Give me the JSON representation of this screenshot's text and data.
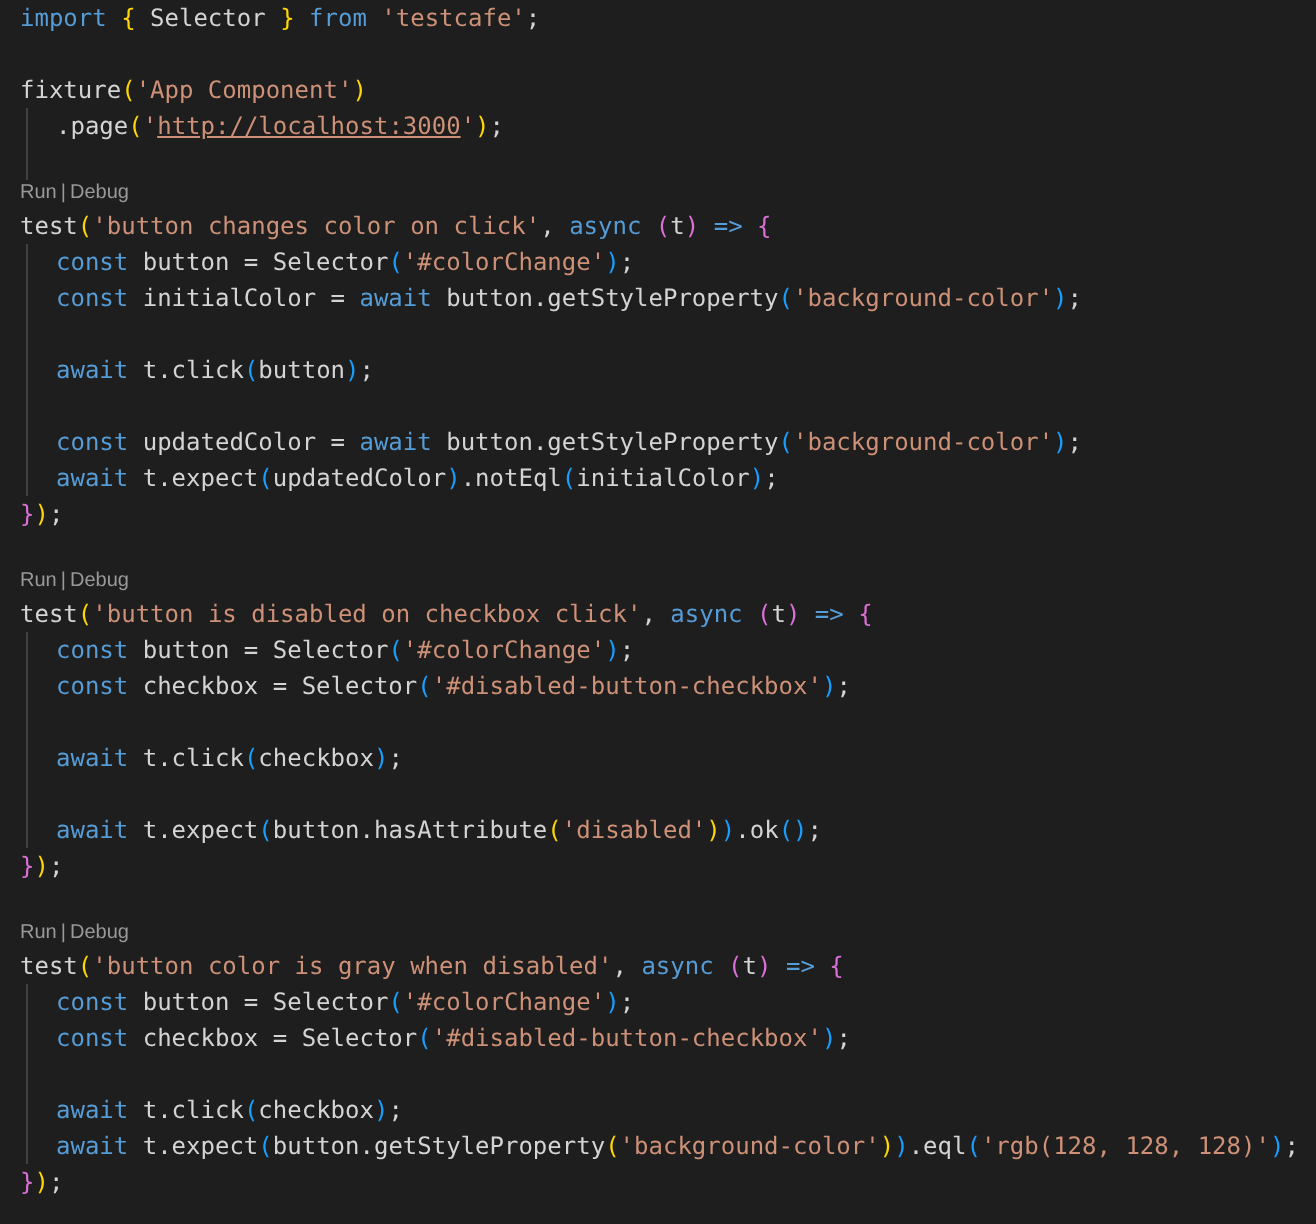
{
  "editor": {
    "lines": [
      {
        "kind": "code",
        "indented": false,
        "tokens": [
          {
            "kind": "keyword",
            "text": "import "
          },
          {
            "kind": "bracket1",
            "text": "{"
          },
          {
            "kind": "plain",
            "text": " Selector "
          },
          {
            "kind": "bracket1",
            "text": "}"
          },
          {
            "kind": "keyword",
            "text": " from "
          },
          {
            "kind": "string",
            "text": "'testcafe'"
          },
          {
            "kind": "plain",
            "text": ";"
          }
        ]
      },
      {
        "kind": "blank",
        "indented": false
      },
      {
        "kind": "code",
        "indented": false,
        "tokens": [
          {
            "kind": "plain",
            "text": "fixture"
          },
          {
            "kind": "bracket1",
            "text": "("
          },
          {
            "kind": "string",
            "text": "'App Component'"
          },
          {
            "kind": "bracket1",
            "text": ")"
          }
        ]
      },
      {
        "kind": "code",
        "indented": true,
        "tokens": [
          {
            "kind": "plain",
            "text": ".page"
          },
          {
            "kind": "bracket1",
            "text": "("
          },
          {
            "kind": "string",
            "text": "'"
          },
          {
            "kind": "link",
            "text": "http://localhost:3000"
          },
          {
            "kind": "string",
            "text": "'"
          },
          {
            "kind": "bracket1",
            "text": ")"
          },
          {
            "kind": "plain",
            "text": ";"
          }
        ]
      },
      {
        "kind": "blank",
        "indented": true
      },
      {
        "kind": "codelens",
        "run": "Run",
        "sep": "|",
        "debug": "Debug"
      },
      {
        "kind": "code",
        "indented": false,
        "tokens": [
          {
            "kind": "plain",
            "text": "test"
          },
          {
            "kind": "bracket1",
            "text": "("
          },
          {
            "kind": "string",
            "text": "'button changes color on click'"
          },
          {
            "kind": "plain",
            "text": ", "
          },
          {
            "kind": "keyword",
            "text": "async "
          },
          {
            "kind": "bracket2",
            "text": "("
          },
          {
            "kind": "plain",
            "text": "t"
          },
          {
            "kind": "bracket2",
            "text": ")"
          },
          {
            "kind": "keyword",
            "text": " => "
          },
          {
            "kind": "bracket2",
            "text": "{"
          }
        ]
      },
      {
        "kind": "code",
        "indented": true,
        "tokens": [
          {
            "kind": "keyword",
            "text": "const "
          },
          {
            "kind": "plain",
            "text": "button = Selector"
          },
          {
            "kind": "bracket3",
            "text": "("
          },
          {
            "kind": "string",
            "text": "'#colorChange'"
          },
          {
            "kind": "bracket3",
            "text": ")"
          },
          {
            "kind": "plain",
            "text": ";"
          }
        ]
      },
      {
        "kind": "code",
        "indented": true,
        "tokens": [
          {
            "kind": "keyword",
            "text": "const "
          },
          {
            "kind": "plain",
            "text": "initialColor = "
          },
          {
            "kind": "keyword",
            "text": "await "
          },
          {
            "kind": "plain",
            "text": "button.getStyleProperty"
          },
          {
            "kind": "bracket3",
            "text": "("
          },
          {
            "kind": "string",
            "text": "'background-color'"
          },
          {
            "kind": "bracket3",
            "text": ")"
          },
          {
            "kind": "plain",
            "text": ";"
          }
        ]
      },
      {
        "kind": "blank",
        "indented": true
      },
      {
        "kind": "code",
        "indented": true,
        "tokens": [
          {
            "kind": "keyword",
            "text": "await "
          },
          {
            "kind": "plain",
            "text": "t.click"
          },
          {
            "kind": "bracket3",
            "text": "("
          },
          {
            "kind": "plain",
            "text": "button"
          },
          {
            "kind": "bracket3",
            "text": ")"
          },
          {
            "kind": "plain",
            "text": ";"
          }
        ]
      },
      {
        "kind": "blank",
        "indented": true
      },
      {
        "kind": "code",
        "indented": true,
        "tokens": [
          {
            "kind": "keyword",
            "text": "const "
          },
          {
            "kind": "plain",
            "text": "updatedColor = "
          },
          {
            "kind": "keyword",
            "text": "await "
          },
          {
            "kind": "plain",
            "text": "button.getStyleProperty"
          },
          {
            "kind": "bracket3",
            "text": "("
          },
          {
            "kind": "string",
            "text": "'background-color'"
          },
          {
            "kind": "bracket3",
            "text": ")"
          },
          {
            "kind": "plain",
            "text": ";"
          }
        ]
      },
      {
        "kind": "code",
        "indented": true,
        "tokens": [
          {
            "kind": "keyword",
            "text": "await "
          },
          {
            "kind": "plain",
            "text": "t.expect"
          },
          {
            "kind": "bracket3",
            "text": "("
          },
          {
            "kind": "plain",
            "text": "updatedColor"
          },
          {
            "kind": "bracket3",
            "text": ")"
          },
          {
            "kind": "plain",
            "text": ".notEql"
          },
          {
            "kind": "bracket3",
            "text": "("
          },
          {
            "kind": "plain",
            "text": "initialColor"
          },
          {
            "kind": "bracket3",
            "text": ")"
          },
          {
            "kind": "plain",
            "text": ";"
          }
        ]
      },
      {
        "kind": "code",
        "indented": false,
        "tokens": [
          {
            "kind": "bracket2",
            "text": "}"
          },
          {
            "kind": "bracket1",
            "text": ")"
          },
          {
            "kind": "plain",
            "text": ";"
          }
        ]
      },
      {
        "kind": "blank",
        "indented": false
      },
      {
        "kind": "codelens",
        "run": "Run",
        "sep": "|",
        "debug": "Debug"
      },
      {
        "kind": "code",
        "indented": false,
        "tokens": [
          {
            "kind": "plain",
            "text": "test"
          },
          {
            "kind": "bracket1",
            "text": "("
          },
          {
            "kind": "string",
            "text": "'button is disabled on checkbox click'"
          },
          {
            "kind": "plain",
            "text": ", "
          },
          {
            "kind": "keyword",
            "text": "async "
          },
          {
            "kind": "bracket2",
            "text": "("
          },
          {
            "kind": "plain",
            "text": "t"
          },
          {
            "kind": "bracket2",
            "text": ")"
          },
          {
            "kind": "keyword",
            "text": " => "
          },
          {
            "kind": "bracket2",
            "text": "{"
          }
        ]
      },
      {
        "kind": "code",
        "indented": true,
        "tokens": [
          {
            "kind": "keyword",
            "text": "const "
          },
          {
            "kind": "plain",
            "text": "button = Selector"
          },
          {
            "kind": "bracket3",
            "text": "("
          },
          {
            "kind": "string",
            "text": "'#colorChange'"
          },
          {
            "kind": "bracket3",
            "text": ")"
          },
          {
            "kind": "plain",
            "text": ";"
          }
        ]
      },
      {
        "kind": "code",
        "indented": true,
        "tokens": [
          {
            "kind": "keyword",
            "text": "const "
          },
          {
            "kind": "plain",
            "text": "checkbox = Selector"
          },
          {
            "kind": "bracket3",
            "text": "("
          },
          {
            "kind": "string",
            "text": "'#disabled-button-checkbox'"
          },
          {
            "kind": "bracket3",
            "text": ")"
          },
          {
            "kind": "plain",
            "text": ";"
          }
        ]
      },
      {
        "kind": "blank",
        "indented": true
      },
      {
        "kind": "code",
        "indented": true,
        "tokens": [
          {
            "kind": "keyword",
            "text": "await "
          },
          {
            "kind": "plain",
            "text": "t.click"
          },
          {
            "kind": "bracket3",
            "text": "("
          },
          {
            "kind": "plain",
            "text": "checkbox"
          },
          {
            "kind": "bracket3",
            "text": ")"
          },
          {
            "kind": "plain",
            "text": ";"
          }
        ]
      },
      {
        "kind": "blank",
        "indented": true
      },
      {
        "kind": "code",
        "indented": true,
        "tokens": [
          {
            "kind": "keyword",
            "text": "await "
          },
          {
            "kind": "plain",
            "text": "t.expect"
          },
          {
            "kind": "bracket3",
            "text": "("
          },
          {
            "kind": "plain",
            "text": "button.hasAttribute"
          },
          {
            "kind": "bracket1",
            "text": "("
          },
          {
            "kind": "string",
            "text": "'disabled'"
          },
          {
            "kind": "bracket1",
            "text": ")"
          },
          {
            "kind": "bracket3",
            "text": ")"
          },
          {
            "kind": "plain",
            "text": ".ok"
          },
          {
            "kind": "bracket3",
            "text": "()"
          },
          {
            "kind": "plain",
            "text": ";"
          }
        ]
      },
      {
        "kind": "code",
        "indented": false,
        "tokens": [
          {
            "kind": "bracket2",
            "text": "}"
          },
          {
            "kind": "bracket1",
            "text": ")"
          },
          {
            "kind": "plain",
            "text": ";"
          }
        ]
      },
      {
        "kind": "blank",
        "indented": false
      },
      {
        "kind": "codelens",
        "run": "Run",
        "sep": "|",
        "debug": "Debug"
      },
      {
        "kind": "code",
        "indented": false,
        "tokens": [
          {
            "kind": "plain",
            "text": "test"
          },
          {
            "kind": "bracket1",
            "text": "("
          },
          {
            "kind": "string",
            "text": "'button color is gray when disabled'"
          },
          {
            "kind": "plain",
            "text": ", "
          },
          {
            "kind": "keyword",
            "text": "async "
          },
          {
            "kind": "bracket2",
            "text": "("
          },
          {
            "kind": "plain",
            "text": "t"
          },
          {
            "kind": "bracket2",
            "text": ")"
          },
          {
            "kind": "keyword",
            "text": " => "
          },
          {
            "kind": "bracket2",
            "text": "{"
          }
        ]
      },
      {
        "kind": "code",
        "indented": true,
        "tokens": [
          {
            "kind": "keyword",
            "text": "const "
          },
          {
            "kind": "plain",
            "text": "button = Selector"
          },
          {
            "kind": "bracket3",
            "text": "("
          },
          {
            "kind": "string",
            "text": "'#colorChange'"
          },
          {
            "kind": "bracket3",
            "text": ")"
          },
          {
            "kind": "plain",
            "text": ";"
          }
        ]
      },
      {
        "kind": "code",
        "indented": true,
        "tokens": [
          {
            "kind": "keyword",
            "text": "const "
          },
          {
            "kind": "plain",
            "text": "checkbox = Selector"
          },
          {
            "kind": "bracket3",
            "text": "("
          },
          {
            "kind": "string",
            "text": "'#disabled-button-checkbox'"
          },
          {
            "kind": "bracket3",
            "text": ")"
          },
          {
            "kind": "plain",
            "text": ";"
          }
        ]
      },
      {
        "kind": "blank",
        "indented": true
      },
      {
        "kind": "code",
        "indented": true,
        "tokens": [
          {
            "kind": "keyword",
            "text": "await "
          },
          {
            "kind": "plain",
            "text": "t.click"
          },
          {
            "kind": "bracket3",
            "text": "("
          },
          {
            "kind": "plain",
            "text": "checkbox"
          },
          {
            "kind": "bracket3",
            "text": ")"
          },
          {
            "kind": "plain",
            "text": ";"
          }
        ]
      },
      {
        "kind": "code",
        "indented": true,
        "tokens": [
          {
            "kind": "keyword",
            "text": "await "
          },
          {
            "kind": "plain",
            "text": "t.expect"
          },
          {
            "kind": "bracket3",
            "text": "("
          },
          {
            "kind": "plain",
            "text": "button.getStyleProperty"
          },
          {
            "kind": "bracket1",
            "text": "("
          },
          {
            "kind": "string",
            "text": "'background-color'"
          },
          {
            "kind": "bracket1",
            "text": ")"
          },
          {
            "kind": "bracket3",
            "text": ")"
          },
          {
            "kind": "plain",
            "text": ".eql"
          },
          {
            "kind": "bracket3",
            "text": "("
          },
          {
            "kind": "string",
            "text": "'rgb(128, 128, 128)'"
          },
          {
            "kind": "bracket3",
            "text": ")"
          },
          {
            "kind": "plain",
            "text": ";"
          }
        ]
      },
      {
        "kind": "code",
        "indented": false,
        "tokens": [
          {
            "kind": "bracket2",
            "text": "}"
          },
          {
            "kind": "bracket1",
            "text": ")"
          },
          {
            "kind": "plain",
            "text": ";"
          }
        ]
      }
    ]
  }
}
